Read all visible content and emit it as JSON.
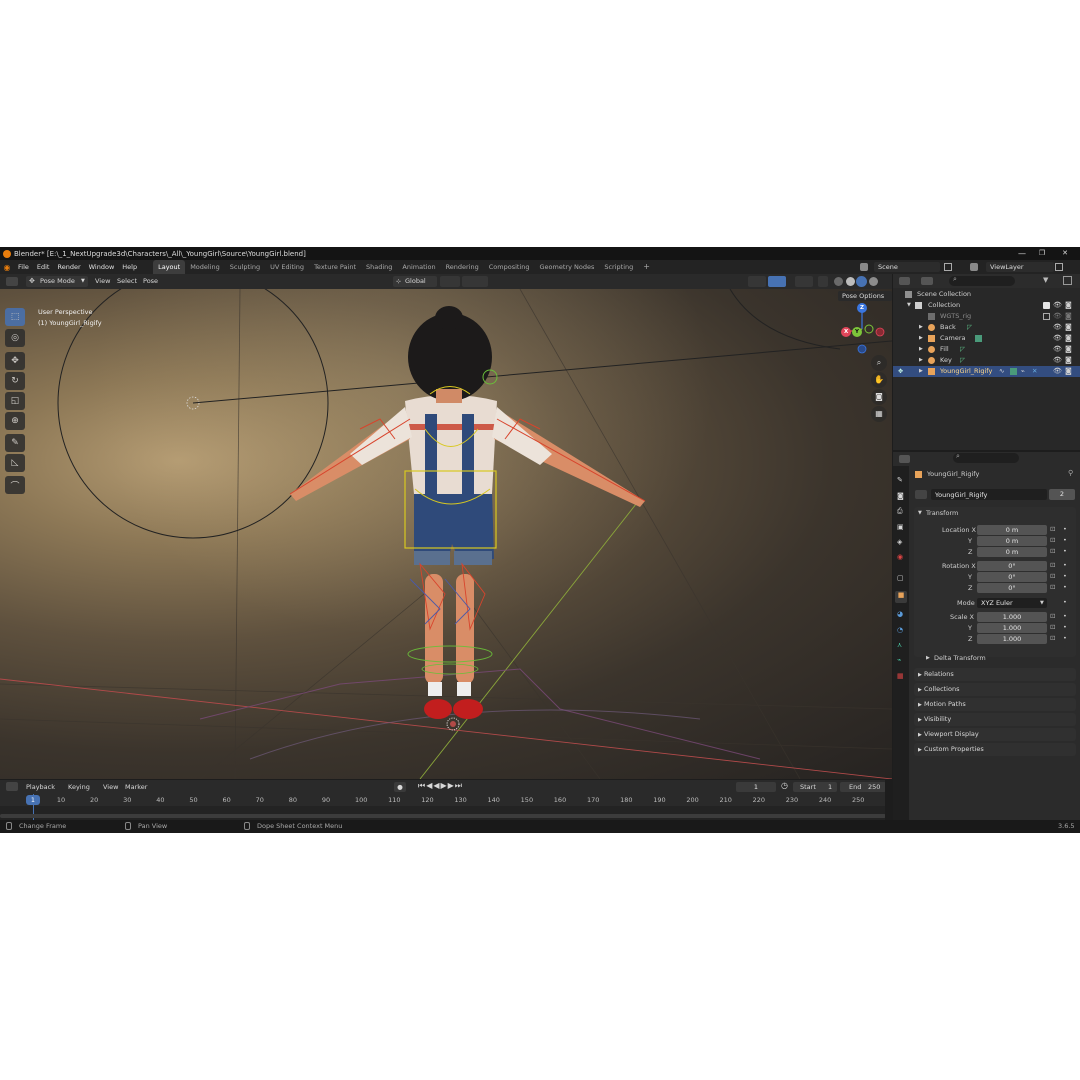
{
  "window": {
    "title": "Blender* [E:\\_1_NextUpgrade3d\\Characters\\_All\\_YoungGirl\\Source\\YoungGirl.blend]",
    "controls": [
      "—",
      "❐",
      "✕"
    ]
  },
  "menu": {
    "items": [
      "File",
      "Edit",
      "Render",
      "Window",
      "Help"
    ],
    "workspaces": [
      "Layout",
      "Modeling",
      "Sculpting",
      "UV Editing",
      "Texture Paint",
      "Shading",
      "Animation",
      "Rendering",
      "Compositing",
      "Geometry Nodes",
      "Scripting"
    ],
    "active_workspace": "Layout",
    "add_tab": "+",
    "scene": "Scene",
    "view_layer": "ViewLayer"
  },
  "viewport_header": {
    "mode": "Pose Mode",
    "menus": [
      "View",
      "Select",
      "Pose"
    ],
    "transform_orientation": "Global",
    "pose_options": "Pose Options"
  },
  "viewport": {
    "perspective": "User Perspective",
    "object_label": "(1) YoungGirl_Rigify",
    "gizmo_axes": [
      "Z",
      "X",
      "Y"
    ]
  },
  "outliner": {
    "search_placeholder": "",
    "root": "Scene Collection",
    "items": [
      {
        "label": "Collection",
        "level": 1
      },
      {
        "label": "WGTS_rig",
        "level": 2
      },
      {
        "label": "Back",
        "level": 2
      },
      {
        "label": "Camera",
        "level": 2
      },
      {
        "label": "Fill",
        "level": 2
      },
      {
        "label": "Key",
        "level": 2
      },
      {
        "label": "YoungGirl_Rigify",
        "level": 2
      }
    ],
    "selected": "YoungGirl_Rigify"
  },
  "properties": {
    "object_name": "YoungGirl_Rigify",
    "data_name": "YoungGirl_Rigify",
    "users": "2",
    "transform_label": "Transform",
    "location": {
      "label": "Location X",
      "y_label": "Y",
      "z_label": "Z",
      "x": "0 m",
      "y": "0 m",
      "z": "0 m"
    },
    "rotation": {
      "label": "Rotation X",
      "y_label": "Y",
      "z_label": "Z",
      "x": "0°",
      "y": "0°",
      "z": "0°"
    },
    "mode_label": "Mode",
    "mode_value": "XYZ Euler",
    "scale": {
      "label": "Scale X",
      "y_label": "Y",
      "z_label": "Z",
      "x": "1.000",
      "y": "1.000",
      "z": "1.000"
    },
    "delta": "Delta Transform",
    "panels": [
      "Relations",
      "Collections",
      "Motion Paths",
      "Visibility",
      "Viewport Display",
      "Custom Properties"
    ]
  },
  "timeline": {
    "menus": [
      "Playback",
      "Keying",
      "View",
      "Marker"
    ],
    "current_frame": "1",
    "start_label": "Start",
    "start": "1",
    "end_label": "End",
    "end": "250",
    "ticks": [
      "1",
      "10",
      "20",
      "30",
      "40",
      "50",
      "60",
      "70",
      "80",
      "90",
      "100",
      "110",
      "120",
      "130",
      "140",
      "150",
      "160",
      "170",
      "180",
      "190",
      "200",
      "210",
      "220",
      "230",
      "240",
      "250"
    ]
  },
  "status": {
    "items": [
      "Change Frame",
      "Pan View",
      "Dope Sheet Context Menu"
    ],
    "version": "3.6.5"
  },
  "colors": {
    "accent": "#4772b3",
    "selection": "#334d80",
    "blender_orange": "#e87d0d",
    "bone_yellow": "#d8c820",
    "bone_red": "#d8442c"
  }
}
